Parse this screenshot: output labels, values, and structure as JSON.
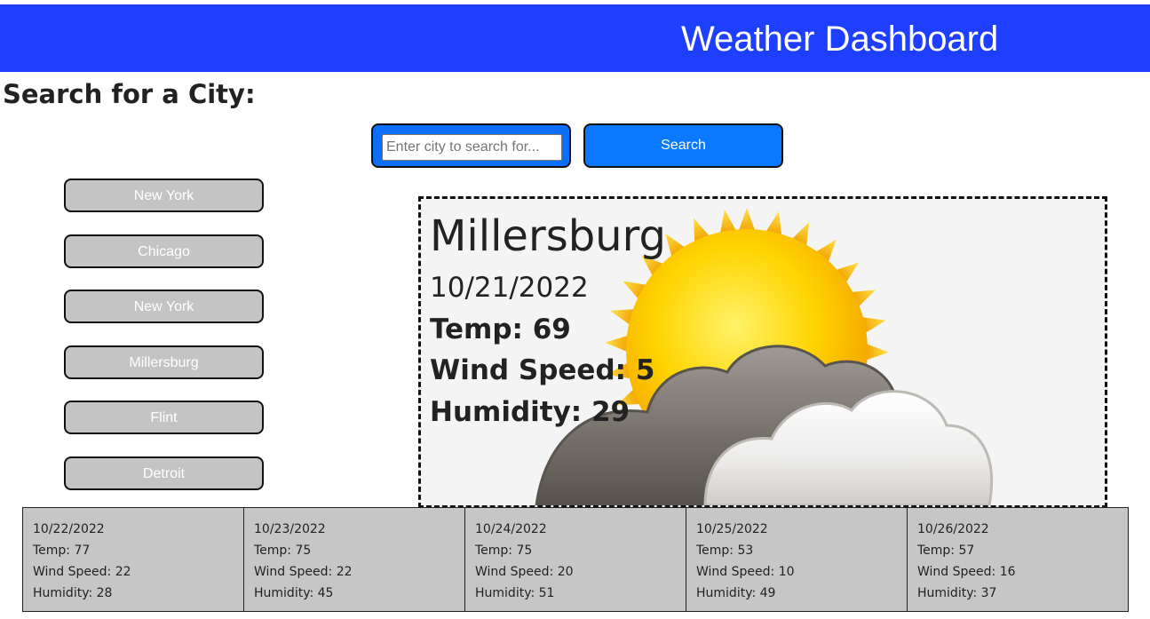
{
  "header": {
    "title": "Weather Dashboard"
  },
  "search": {
    "heading": "Search for a City:",
    "placeholder": "Enter city to search for...",
    "button_label": "Search"
  },
  "history": {
    "items": [
      {
        "label": "New York"
      },
      {
        "label": "Chicago"
      },
      {
        "label": "New York"
      },
      {
        "label": "Millersburg"
      },
      {
        "label": "Flint"
      },
      {
        "label": "Detroit"
      }
    ]
  },
  "current": {
    "city": "Millersburg",
    "date": "10/21/2022",
    "temp": "Temp: 69",
    "wind": "Wind Speed: 5",
    "humidity": "Humidity: 29",
    "icon": "partly-cloudy-icon"
  },
  "forecast": [
    {
      "date": "10/22/2022",
      "temp": "Temp:  77",
      "wind": "Wind  Speed:  22",
      "humidity": "Humidity:  28"
    },
    {
      "date": "10/23/2022",
      "temp": "Temp:  75",
      "wind": "Wind  Speed:  22",
      "humidity": "Humidity:  45"
    },
    {
      "date": "10/24/2022",
      "temp": "Temp:  75",
      "wind": "Wind  Speed:  20",
      "humidity": "Humidity:  51"
    },
    {
      "date": "10/25/2022",
      "temp": "Temp:  53",
      "wind": "Wind  Speed:  10",
      "humidity": "Humidity:  49"
    },
    {
      "date": "10/26/2022",
      "temp": "Temp:  57",
      "wind": "Wind  Speed:  16",
      "humidity": "Humidity:  37"
    }
  ],
  "colors": {
    "header_bg": "#1e3fff",
    "search_button_bg": "#0a78ff",
    "input_wrap_bg": "#0d6efd",
    "history_button_bg": "#c4c4c4",
    "forecast_card_bg": "#c6c6c6",
    "current_panel_bg": "#f4f4f4"
  }
}
